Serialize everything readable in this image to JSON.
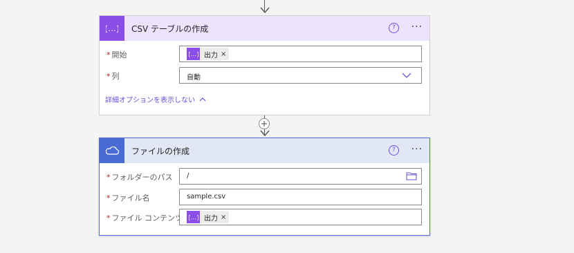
{
  "colors": {
    "csv_header_bg": "#ede3fd",
    "csv_icon_bg": "#8b4ee6",
    "onedrive_header_bg": "#e2e7f6",
    "onedrive_icon_bg": "#4a6bd4",
    "accent": "#6b4fd8",
    "required": "#a4262c"
  },
  "csv_card": {
    "title": "CSV テーブルの作成",
    "icon": "code-braces-icon",
    "help_label": "?",
    "more_label": "···",
    "fields": [
      {
        "required": "*",
        "label": "開始",
        "token": {
          "label": "出力",
          "remove": "×",
          "icon": "code-braces-icon"
        }
      },
      {
        "required": "*",
        "label": "列",
        "value": "自動",
        "control": "chevron-down-icon"
      }
    ],
    "advanced_link": "詳細オプションを表示しない",
    "advanced_icon": "chevron-up-icon"
  },
  "add_step": {
    "icon": "plus-icon"
  },
  "file_card": {
    "title": "ファイルの作成",
    "icon": "onedrive-cloud-icon",
    "help_label": "?",
    "more_label": "···",
    "fields": [
      {
        "required": "*",
        "label": "フォルダーのパス",
        "value": "/",
        "control": "folder-icon"
      },
      {
        "required": "*",
        "label": "ファイル名",
        "value": "sample.csv"
      },
      {
        "required": "*",
        "label": "ファイル コンテンツ",
        "token": {
          "label": "出力",
          "remove": "×",
          "icon": "code-braces-icon"
        }
      }
    ]
  }
}
